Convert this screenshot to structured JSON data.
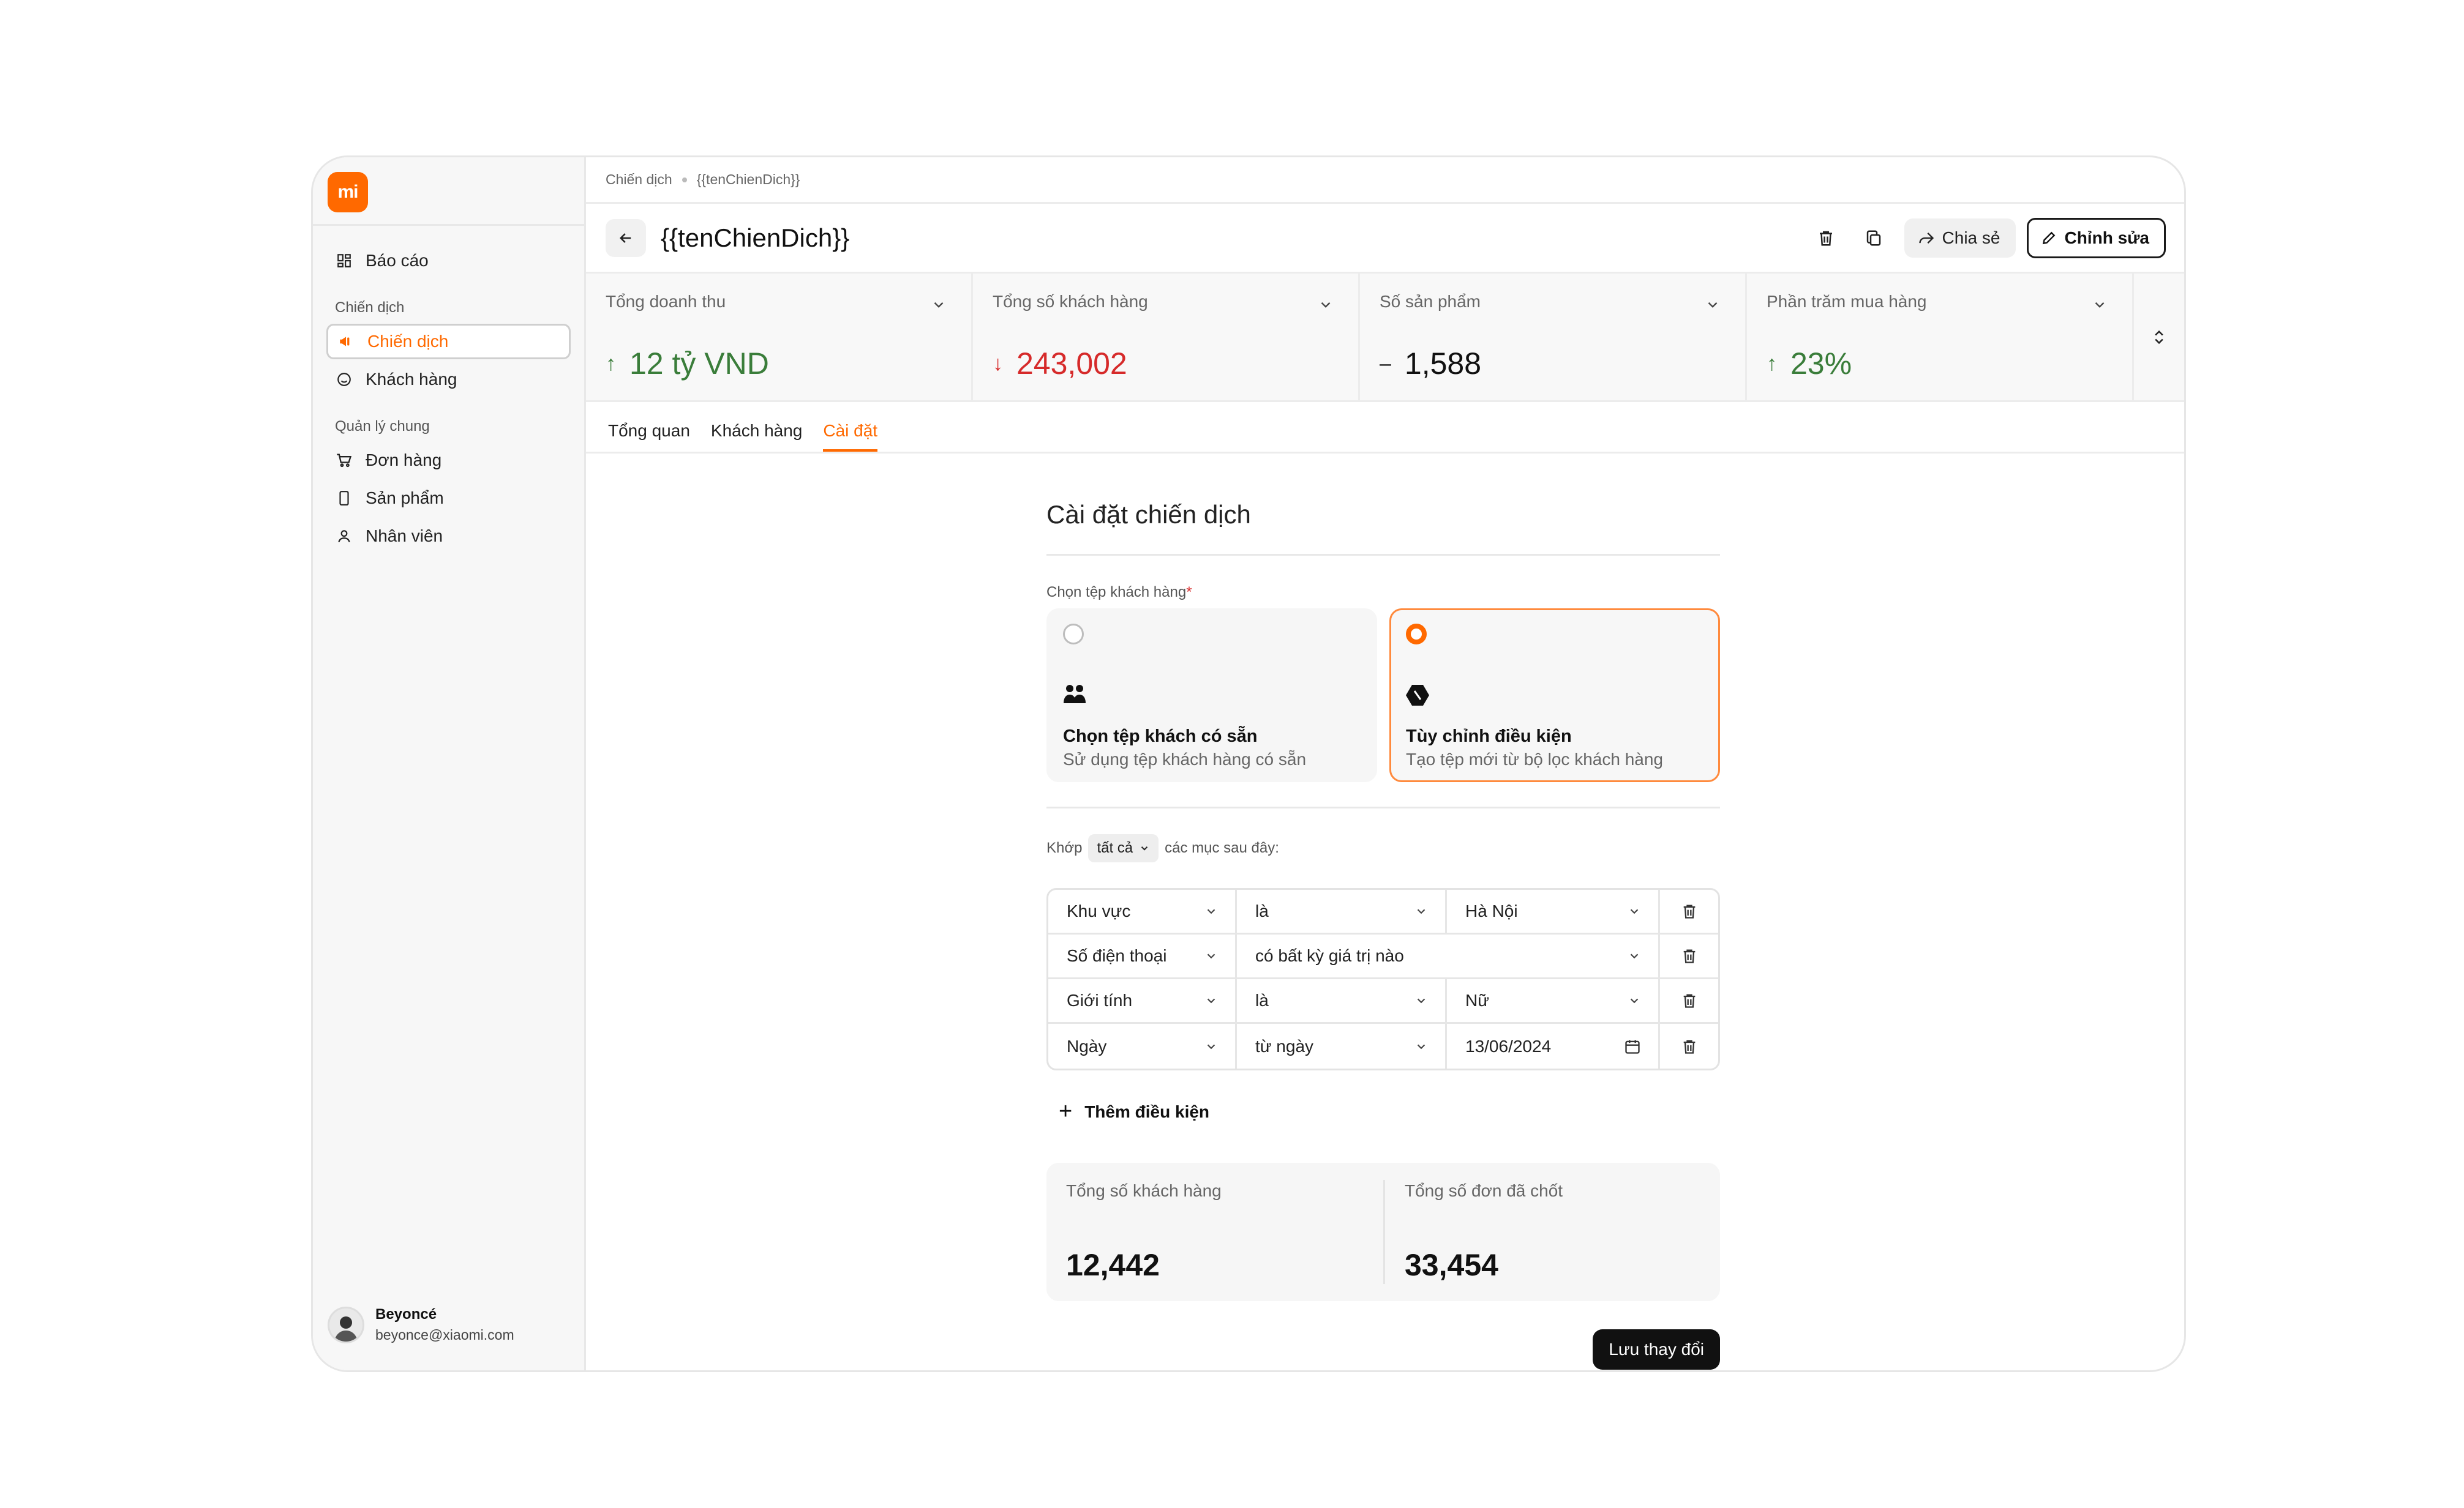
{
  "brand": {
    "logo_text": "mi",
    "accent": "#ff6900"
  },
  "sidebar": {
    "items_top": [
      {
        "label": "Báo cáo",
        "icon": "dashboard-icon"
      }
    ],
    "section_campaign": "Chiến dịch",
    "items_campaign": [
      {
        "label": "Chiến dịch",
        "icon": "megaphone-icon",
        "active": true
      },
      {
        "label": "Khách hàng",
        "icon": "smile-icon"
      }
    ],
    "section_manage": "Quản lý chung",
    "items_manage": [
      {
        "label": "Đơn hàng",
        "icon": "cart-icon"
      },
      {
        "label": "Sản phẩm",
        "icon": "phone-icon"
      },
      {
        "label": "Nhân viên",
        "icon": "person-icon"
      }
    ],
    "profile": {
      "name": "Beyoncé",
      "email": "beyonce@xiaomi.com"
    }
  },
  "breadcrumb": {
    "root": "Chiến dịch",
    "current": "{{tenChienDich}}"
  },
  "header": {
    "title": "{{tenChienDich}}",
    "share_label": "Chia sẻ",
    "edit_label": "Chỉnh sửa"
  },
  "stats": [
    {
      "label": "Tổng doanh thu",
      "value": "12 tỷ VND",
      "trend": "up"
    },
    {
      "label": "Tổng số khách hàng",
      "value": "243,002",
      "trend": "down"
    },
    {
      "label": "Số sản phẩm",
      "value": "1,588",
      "trend": "flat"
    },
    {
      "label": "Phần trăm mua hàng",
      "value": "23%",
      "trend": "up"
    }
  ],
  "tabs": [
    {
      "label": "Tổng quan"
    },
    {
      "label": "Khách hàng"
    },
    {
      "label": "Cài đặt",
      "active": true
    }
  ],
  "settings": {
    "title": "Cài đặt chiến dịch",
    "customer_file_label": "Chọn tệp khách hàng",
    "required_mark": "*",
    "choices": [
      {
        "title": "Chọn tệp khách có sẵn",
        "desc": "Sử dụng tệp khách hàng có sẵn",
        "selected": false,
        "icon": "people-icon"
      },
      {
        "title": "Tùy chỉnh điều kiện",
        "desc": "Tạo tệp mới từ bộ lọc khách hàng",
        "selected": true,
        "icon": "filter-shape-icon"
      }
    ],
    "match_prefix": "Khớp",
    "match_value": "tất cả",
    "match_suffix": "các mục sau đây:",
    "conditions": [
      {
        "field": "Khu vực",
        "operator": "là",
        "value": "Hà Nội"
      },
      {
        "field": "Số điện thoại",
        "operator": "có bất kỳ giá trị nào",
        "value": ""
      },
      {
        "field": "Giới tính",
        "operator": "là",
        "value": "Nữ"
      },
      {
        "field": "Ngày",
        "operator": "từ ngày",
        "value": "13/06/2024"
      }
    ],
    "add_condition_label": "Thêm điều kiện",
    "summary": [
      {
        "label": "Tổng số khách hàng",
        "value": "12,442"
      },
      {
        "label": "Tổng số đơn đã chốt",
        "value": "33,454"
      }
    ],
    "save_label": "Lưu thay đổi"
  }
}
